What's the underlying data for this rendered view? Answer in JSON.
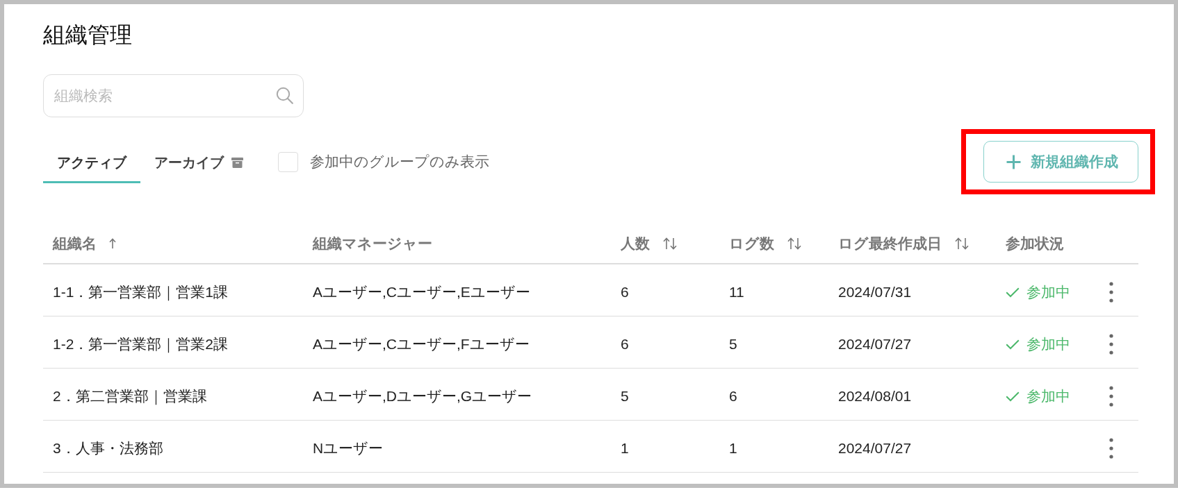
{
  "page": {
    "title": "組織管理"
  },
  "search": {
    "placeholder": "組織検索"
  },
  "tabs": [
    {
      "label": "アクティブ",
      "selected": true,
      "kind": "plain"
    },
    {
      "label": "アーカイブ",
      "selected": false,
      "kind": "archive"
    }
  ],
  "filter": {
    "label": "参加中のグループのみ表示",
    "checked": false
  },
  "create_button": {
    "label": "新規組織作成",
    "highlighted": true
  },
  "table": {
    "columns": [
      {
        "label": "組織名",
        "sortable": true,
        "sorted": true
      },
      {
        "label": "組織マネージャー",
        "sortable": false,
        "sorted": false
      },
      {
        "label": "人数",
        "sortable": true,
        "sorted": false
      },
      {
        "label": "ログ数",
        "sortable": true,
        "sorted": false
      },
      {
        "label": "ログ最終作成日",
        "sortable": true,
        "sorted": false
      },
      {
        "label": "参加状況",
        "sortable": false,
        "sorted": false
      }
    ],
    "rows": [
      {
        "name": "1-1．第一営業部｜営業1課",
        "managers": "Aユーザー,Cユーザー,Eユーザー",
        "members": "6",
        "logs": "11",
        "last_log": "2024/07/31",
        "joined": true,
        "status": "参加中"
      },
      {
        "name": "1-2．第一営業部｜営業2課",
        "managers": "Aユーザー,Cユーザー,Fユーザー",
        "members": "6",
        "logs": "5",
        "last_log": "2024/07/27",
        "joined": true,
        "status": "参加中"
      },
      {
        "name": "2．第二営業部｜営業課",
        "managers": "Aユーザー,Dユーザー,Gユーザー",
        "members": "5",
        "logs": "6",
        "last_log": "2024/08/01",
        "joined": true,
        "status": "参加中"
      },
      {
        "name": "3．人事・法務部",
        "managers": "Nユーザー",
        "members": "1",
        "logs": "1",
        "last_log": "2024/07/27",
        "joined": false
      }
    ]
  }
}
